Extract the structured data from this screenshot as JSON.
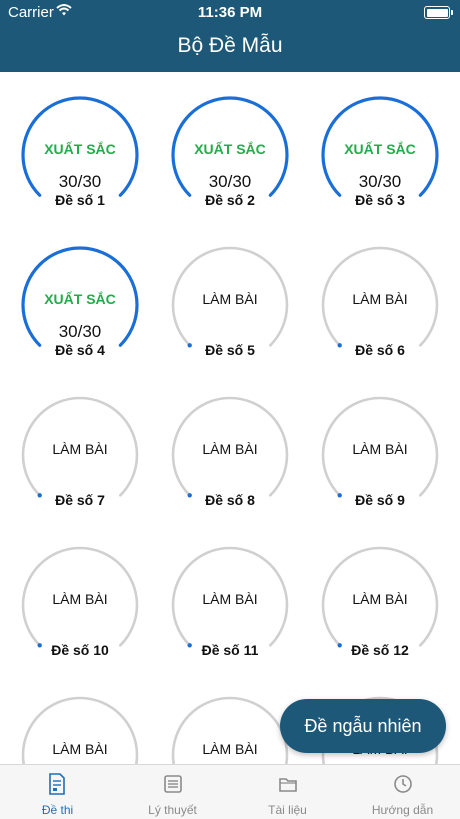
{
  "status_bar": {
    "carrier": "Carrier",
    "time": "11:36 PM"
  },
  "header": {
    "title": "Bộ Đề Mẫu"
  },
  "tests": [
    {
      "name": "Đề số 1",
      "status": "XUẤT SẮC",
      "score": "30/30",
      "completed": true
    },
    {
      "name": "Đề số 2",
      "status": "XUẤT SẮC",
      "score": "30/30",
      "completed": true
    },
    {
      "name": "Đề số 3",
      "status": "XUẤT SẮC",
      "score": "30/30",
      "completed": true
    },
    {
      "name": "Đề số 4",
      "status": "XUẤT SẮC",
      "score": "30/30",
      "completed": true
    },
    {
      "name": "Đề số 5",
      "status": "LÀM BÀI",
      "score": "",
      "completed": false
    },
    {
      "name": "Đề số 6",
      "status": "LÀM BÀI",
      "score": "",
      "completed": false
    },
    {
      "name": "Đề số 7",
      "status": "LÀM BÀI",
      "score": "",
      "completed": false
    },
    {
      "name": "Đề số 8",
      "status": "LÀM BÀI",
      "score": "",
      "completed": false
    },
    {
      "name": "Đề số 9",
      "status": "LÀM BÀI",
      "score": "",
      "completed": false
    },
    {
      "name": "Đề số 10",
      "status": "LÀM BÀI",
      "score": "",
      "completed": false
    },
    {
      "name": "Đề số 11",
      "status": "LÀM BÀI",
      "score": "",
      "completed": false
    },
    {
      "name": "Đề số 12",
      "status": "LÀM BÀI",
      "score": "",
      "completed": false
    },
    {
      "name": "",
      "status": "LÀM BÀI",
      "score": "",
      "completed": false
    },
    {
      "name": "",
      "status": "LÀM BÀI",
      "score": "",
      "completed": false
    },
    {
      "name": "",
      "status": "LÀM BÀI",
      "score": "",
      "completed": false
    }
  ],
  "fab": {
    "label": "Đề ngẫu nhiên"
  },
  "tabs": [
    {
      "label": "Đề thi",
      "icon": "exam-sheet-icon",
      "active": true
    },
    {
      "label": "Lý thuyết",
      "icon": "book-icon",
      "active": false
    },
    {
      "label": "Tài liệu",
      "icon": "folder-icon",
      "active": false
    },
    {
      "label": "Hướng dẫn",
      "icon": "clock-icon",
      "active": false
    }
  ],
  "colors": {
    "header": "#1e5878",
    "progress_full": "#1a6ed8",
    "progress_empty": "#d0d0d0",
    "excellent_text": "#22ad4a",
    "tab_active": "#1e6fb8",
    "tab_inactive": "#8a8a8a"
  }
}
